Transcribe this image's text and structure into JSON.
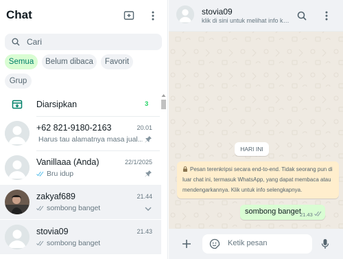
{
  "left": {
    "title": "Chat",
    "search_placeholder": "Cari",
    "filters": [
      "Semua",
      "Belum dibaca",
      "Favorit",
      "Grup"
    ],
    "archived": {
      "label": "Diarsipkan",
      "count": "3"
    },
    "chats": [
      {
        "name": "+62 821-9180-2163",
        "time": "20.01",
        "preview": "Harus tau alamatnya masa jual...",
        "status": "read",
        "pinned": true
      },
      {
        "name": "Vanillaaa (Anda)",
        "time": "22/1/2025",
        "preview": "Bru idup",
        "status": "read",
        "pinned": true
      },
      {
        "name": "zakyaf689",
        "time": "21.44",
        "preview": "sombong banget",
        "status": "sent",
        "dropdown": true
      },
      {
        "name": "stovia09",
        "time": "21.43",
        "preview": "sombong banget",
        "status": "sent",
        "selected": true
      }
    ]
  },
  "right": {
    "contact_name": "stovia09",
    "contact_sub": "klik di sini untuk melihat info kontak",
    "date_label": "HARI INI",
    "encryption_note": "Pesan terenkripsi secara end-to-end. Tidak seorang pun di luar chat ini, termasuk WhatsApp, yang dapat membaca atau mendengarkannya. Klik untuk info selengkapnya.",
    "message": {
      "text": "sombong banget",
      "time": "21.43"
    },
    "composer_placeholder": "Ketik pesan"
  },
  "colors": {
    "accent": "#008069",
    "unread": "#25d366",
    "bubble_out": "#d9fdd3",
    "chat_bg": "#efeae2"
  }
}
